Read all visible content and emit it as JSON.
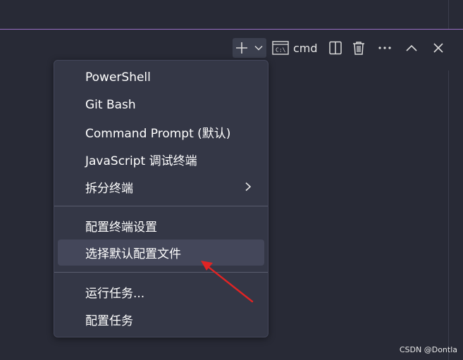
{
  "toolbar": {
    "new_terminal_icon": "plus-icon",
    "profile_dropdown_icon": "chevron-down-icon",
    "terminal_icon": "terminal-window-icon",
    "active_terminal_label": "cmd",
    "split_icon": "split-panel-icon",
    "kill_icon": "trash-icon",
    "more_icon": "ellipsis-icon",
    "maximize_icon": "chevron-up-icon",
    "close_icon": "close-icon"
  },
  "menu": {
    "group1": [
      {
        "label": "PowerShell"
      },
      {
        "label": "Git Bash"
      },
      {
        "label": "Command Prompt (默认)"
      },
      {
        "label": "JavaScript 调试终端"
      },
      {
        "label": "拆分终端",
        "submenu_icon": "chevron-right-icon"
      }
    ],
    "group2": [
      {
        "label": "配置终端设置"
      },
      {
        "label": "选择默认配置文件",
        "selected": true
      }
    ],
    "group3": [
      {
        "label": "运行任务..."
      },
      {
        "label": "配置任务"
      }
    ]
  },
  "annotation": {
    "arrow_color": "#e02424"
  },
  "watermark": "CSDN @Dontla",
  "colors": {
    "background": "#282a36",
    "menu_background": "#343746",
    "menu_selected": "#44475a",
    "panel_border_accent": "#9a6fc4"
  }
}
